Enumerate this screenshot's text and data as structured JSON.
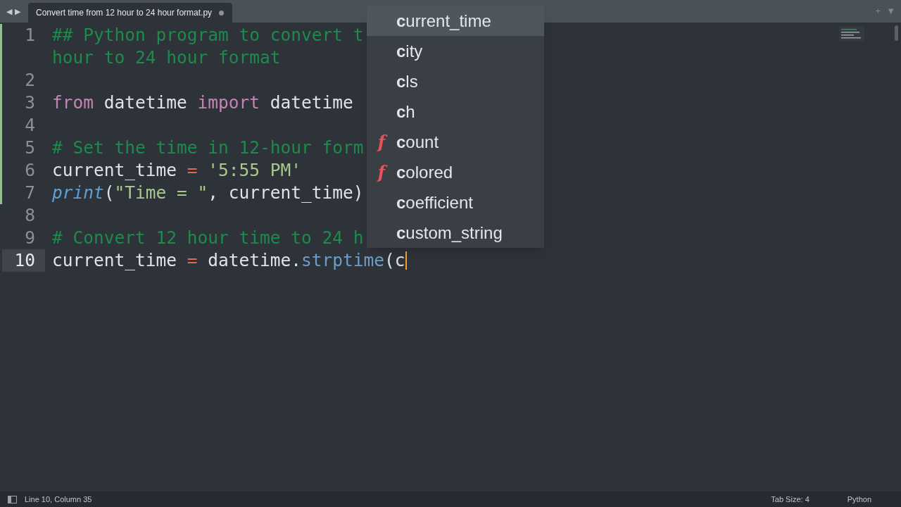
{
  "tab_bar": {
    "nav_arrows": [
      "◀",
      "▶"
    ],
    "tabs": [
      {
        "title": "Convert time from 12 hour to 24 hour format.py",
        "selected": true,
        "dirty": true
      }
    ],
    "actions": [
      "+",
      "▼"
    ]
  },
  "editor": {
    "lines": [
      {
        "number": "1",
        "modified": true,
        "current": false,
        "rows": [
          [
            {
              "kind": "comment",
              "text": "## Python program to convert t"
            }
          ],
          [
            {
              "kind": "comment",
              "text": "hour to 24 hour format"
            }
          ]
        ]
      },
      {
        "number": "2",
        "modified": true,
        "current": false
      },
      {
        "number": "3",
        "modified": true,
        "current": false,
        "rows": [
          [
            {
              "kind": "keyword",
              "text": "from"
            },
            {
              "kind": "plain",
              "text": " datetime "
            },
            {
              "kind": "keyword",
              "text": "import"
            },
            {
              "kind": "plain",
              "text": " datetime"
            }
          ]
        ]
      },
      {
        "number": "4",
        "modified": true,
        "current": false
      },
      {
        "number": "5",
        "modified": true,
        "current": false,
        "rows": [
          [
            {
              "kind": "comment",
              "text": "# Set the time in 12-hour form"
            }
          ]
        ]
      },
      {
        "number": "6",
        "modified": true,
        "current": false,
        "rows": [
          [
            {
              "kind": "plain",
              "text": "current_time "
            },
            {
              "kind": "operator",
              "text": "="
            },
            {
              "kind": "plain",
              "text": " "
            },
            {
              "kind": "string",
              "text": "'5:55 PM'"
            }
          ]
        ]
      },
      {
        "number": "7",
        "modified": true,
        "current": false,
        "rows": [
          [
            {
              "kind": "builtin",
              "text": "print"
            },
            {
              "kind": "plain",
              "text": "("
            },
            {
              "kind": "string",
              "text": "\"Time = \""
            },
            {
              "kind": "plain",
              "text": ", current_time)"
            }
          ]
        ]
      },
      {
        "number": "8",
        "modified": false,
        "current": false
      },
      {
        "number": "9",
        "modified": false,
        "current": false,
        "rows": [
          [
            {
              "kind": "comment",
              "text": "# Convert 12 hour time to 24 h"
            }
          ]
        ]
      },
      {
        "number": "10",
        "modified": false,
        "current": true,
        "rows": [
          [
            {
              "kind": "plain",
              "text": "current_time "
            },
            {
              "kind": "operator",
              "text": "="
            },
            {
              "kind": "plain",
              "text": " datetime."
            },
            {
              "kind": "method",
              "text": "strptime"
            },
            {
              "kind": "plain",
              "text": "(c"
            }
          ]
        ]
      }
    ]
  },
  "autocomplete": {
    "items": [
      {
        "label": "**c**urrent_time",
        "kind": "word",
        "selected": true
      },
      {
        "label": "**c**ity",
        "kind": "word",
        "selected": false
      },
      {
        "label": "**c**ls",
        "kind": "word",
        "selected": false
      },
      {
        "label": "**c**h",
        "kind": "word",
        "selected": false
      },
      {
        "label": "**c**ount",
        "kind": "function",
        "icon": "f",
        "selected": false
      },
      {
        "label": "**c**olored",
        "kind": "function",
        "icon": "f",
        "selected": false
      },
      {
        "label": "**c**oefficient",
        "kind": "word",
        "selected": false
      },
      {
        "label": "**c**ustom_string",
        "kind": "word",
        "selected": false
      }
    ]
  },
  "status_bar": {
    "position": "Line 10, Column 35",
    "tab_size": "Tab Size: 4",
    "syntax": "Python"
  }
}
